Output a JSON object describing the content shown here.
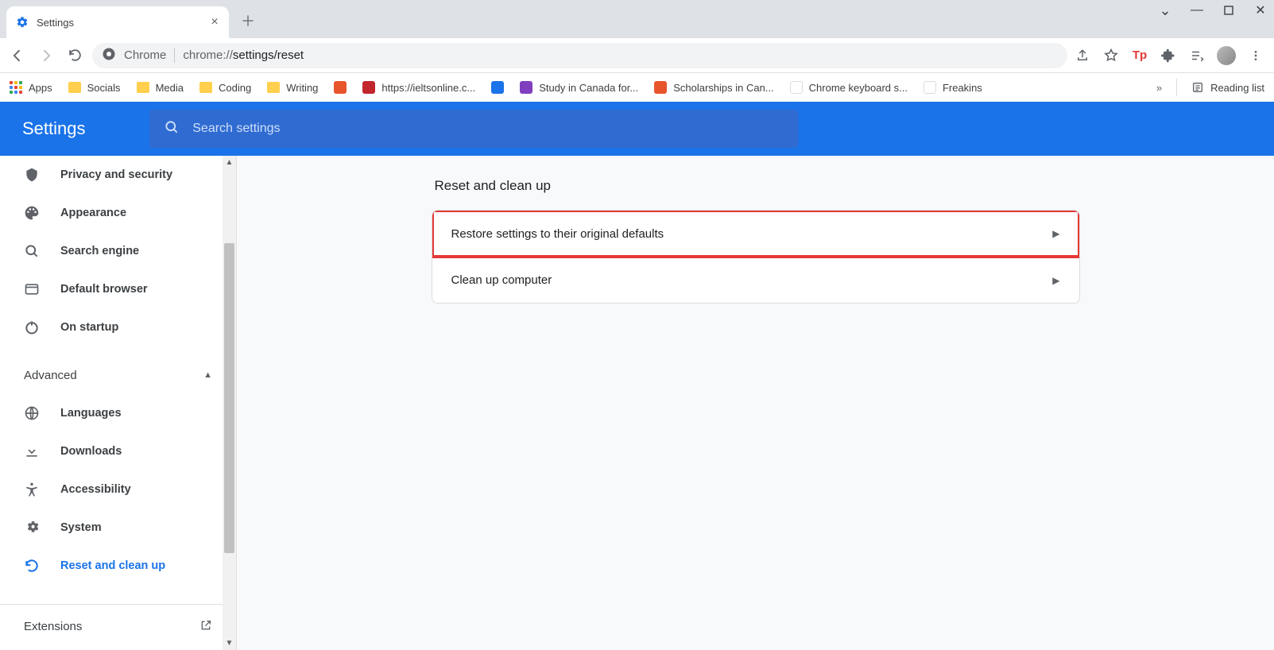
{
  "tab": {
    "title": "Settings"
  },
  "omnibox": {
    "chip": "Chrome",
    "proto": "chrome://",
    "path": "settings/reset"
  },
  "bookmarks": {
    "apps": "Apps",
    "items": [
      {
        "label": "Socials",
        "kind": "folder"
      },
      {
        "label": "Media",
        "kind": "folder"
      },
      {
        "label": "Coding",
        "kind": "folder"
      },
      {
        "label": "Writing",
        "kind": "folder"
      },
      {
        "label": "",
        "kind": "fav",
        "color": "#e8552d"
      },
      {
        "label": "https://ieltsonline.c...",
        "kind": "fav",
        "color": "#c2262d"
      },
      {
        "label": "",
        "kind": "fav",
        "color": "#1a73e8"
      },
      {
        "label": "Study in Canada for...",
        "kind": "fav",
        "color": "#7f3fbf"
      },
      {
        "label": "Scholarships in Can...",
        "kind": "fav",
        "color": "#e8552d"
      },
      {
        "label": "Chrome keyboard s...",
        "kind": "fav",
        "color": "#ffffff"
      },
      {
        "label": "Freakins",
        "kind": "fav",
        "color": "#ffffff"
      }
    ],
    "reading_list": "Reading list"
  },
  "header": {
    "title": "Settings",
    "search_placeholder": "Search settings"
  },
  "sidebar": {
    "items": [
      {
        "id": "privacy",
        "label": "Privacy and security"
      },
      {
        "id": "appearance",
        "label": "Appearance"
      },
      {
        "id": "search",
        "label": "Search engine"
      },
      {
        "id": "default-browser",
        "label": "Default browser"
      },
      {
        "id": "startup",
        "label": "On startup"
      }
    ],
    "advanced": "Advanced",
    "adv_items": [
      {
        "id": "languages",
        "label": "Languages"
      },
      {
        "id": "downloads",
        "label": "Downloads"
      },
      {
        "id": "accessibility",
        "label": "Accessibility"
      },
      {
        "id": "system",
        "label": "System"
      },
      {
        "id": "reset",
        "label": "Reset and clean up",
        "active": true
      }
    ],
    "extensions": "Extensions"
  },
  "main": {
    "section_title": "Reset and clean up",
    "rows": [
      {
        "label": "Restore settings to their original defaults",
        "highlight": true
      },
      {
        "label": "Clean up computer",
        "highlight": false
      }
    ]
  }
}
